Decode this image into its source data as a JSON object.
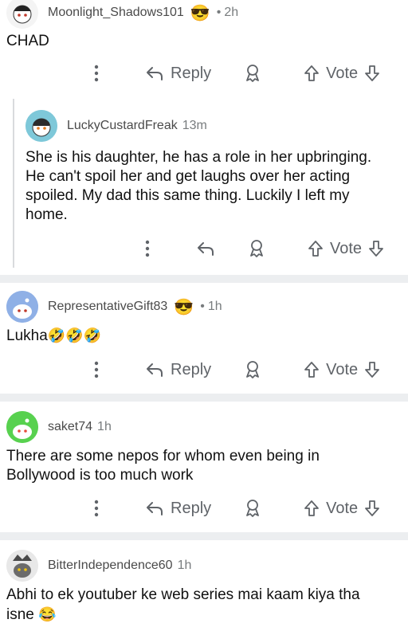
{
  "comments": [
    {
      "username": "Moonlight_Shadows101",
      "badge": "😎",
      "time": "2h",
      "text": "CHAD",
      "reply_label": "Reply",
      "vote_label": "Vote"
    },
    {
      "username": "LuckyCustardFreak",
      "time": "13m",
      "text": "She is his daughter, he has a role in her upbringing. He can't spoil her and get laughs over her acting spoiled. My dad this same thing. Luckily I left my home.",
      "vote_label": "Vote"
    },
    {
      "username": "RepresentativeGift83",
      "badge": "😎",
      "time": "1h",
      "text": "Lukha",
      "emojis": "🤣🤣🤣",
      "reply_label": "Reply",
      "vote_label": "Vote"
    },
    {
      "username": "saket74",
      "time": "1h",
      "text": "There are some nepos for whom even being in Bollywood is too much work",
      "reply_label": "Reply",
      "vote_label": "Vote"
    },
    {
      "username": "BitterIndependence60",
      "time": "1h",
      "text": "Abhi to ek youtuber ke web series mai kaam kiya tha isne",
      "emojis": "😂"
    }
  ],
  "icons": {
    "more": "kebab-menu-icon",
    "reply": "reply-arrow-icon",
    "award": "award-ribbon-icon",
    "upvote": "upvote-arrow-icon",
    "downvote": "downvote-arrow-icon"
  },
  "colors": {
    "background": "#eceef0",
    "card": "#ffffff",
    "muted": "#787c7e"
  }
}
